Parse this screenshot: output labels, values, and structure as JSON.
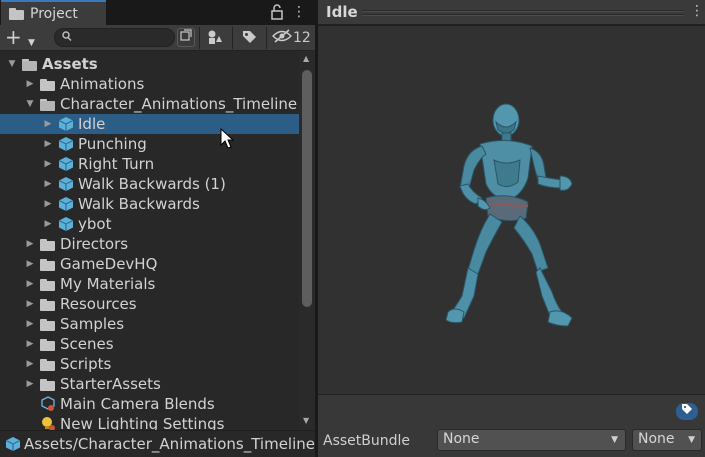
{
  "project_panel": {
    "tab_label": "Project",
    "hidden_packages_count": "12",
    "search": {
      "value": "",
      "placeholder": ""
    },
    "tree": [
      {
        "label": "Assets",
        "icon": "folder-open-icon",
        "expanded": true,
        "bold": true,
        "depth": 0
      },
      {
        "label": "Animations",
        "icon": "folder-icon",
        "expanded": false,
        "depth": 1
      },
      {
        "label": "Character_Animations_Timeline",
        "icon": "folder-open-icon",
        "expanded": true,
        "depth": 1
      },
      {
        "label": "Idle",
        "icon": "animation-model-icon",
        "expanded": false,
        "selected": true,
        "depth": 2
      },
      {
        "label": "Punching",
        "icon": "animation-model-icon",
        "expanded": false,
        "depth": 2
      },
      {
        "label": "Right Turn",
        "icon": "animation-model-icon",
        "expanded": false,
        "depth": 2
      },
      {
        "label": "Walk Backwards (1)",
        "icon": "animation-model-icon",
        "expanded": false,
        "depth": 2
      },
      {
        "label": "Walk Backwards",
        "icon": "animation-model-icon",
        "expanded": false,
        "depth": 2
      },
      {
        "label": "ybot",
        "icon": "animation-model-icon",
        "expanded": false,
        "depth": 2
      },
      {
        "label": "Directors",
        "icon": "folder-icon",
        "expanded": false,
        "depth": 1
      },
      {
        "label": "GameDevHQ",
        "icon": "folder-icon",
        "expanded": false,
        "depth": 1
      },
      {
        "label": "My Materials",
        "icon": "folder-icon",
        "expanded": false,
        "depth": 1
      },
      {
        "label": "Resources",
        "icon": "folder-icon",
        "expanded": false,
        "depth": 1
      },
      {
        "label": "Samples",
        "icon": "folder-icon",
        "expanded": false,
        "depth": 1
      },
      {
        "label": "Scenes",
        "icon": "folder-icon",
        "expanded": false,
        "depth": 1
      },
      {
        "label": "Scripts",
        "icon": "folder-icon",
        "expanded": false,
        "depth": 1
      },
      {
        "label": "StarterAssets",
        "icon": "folder-icon",
        "expanded": false,
        "depth": 1
      },
      {
        "label": "Main Camera Blends",
        "icon": "camera-blend-icon",
        "depth": 1
      },
      {
        "label": "New Lighting Settings",
        "icon": "lighting-settings-icon",
        "depth": 1
      }
    ],
    "path_bar": "Assets/Character_Animations_Timeline/"
  },
  "preview_panel": {
    "title": "Idle",
    "asset_bundle": {
      "label": "AssetBundle",
      "name_value": "None",
      "variant_value": "None"
    }
  },
  "colors": {
    "selection": "#2c5d87",
    "model_body": "#4e8aa0",
    "tag_button": "#2e5f93"
  }
}
